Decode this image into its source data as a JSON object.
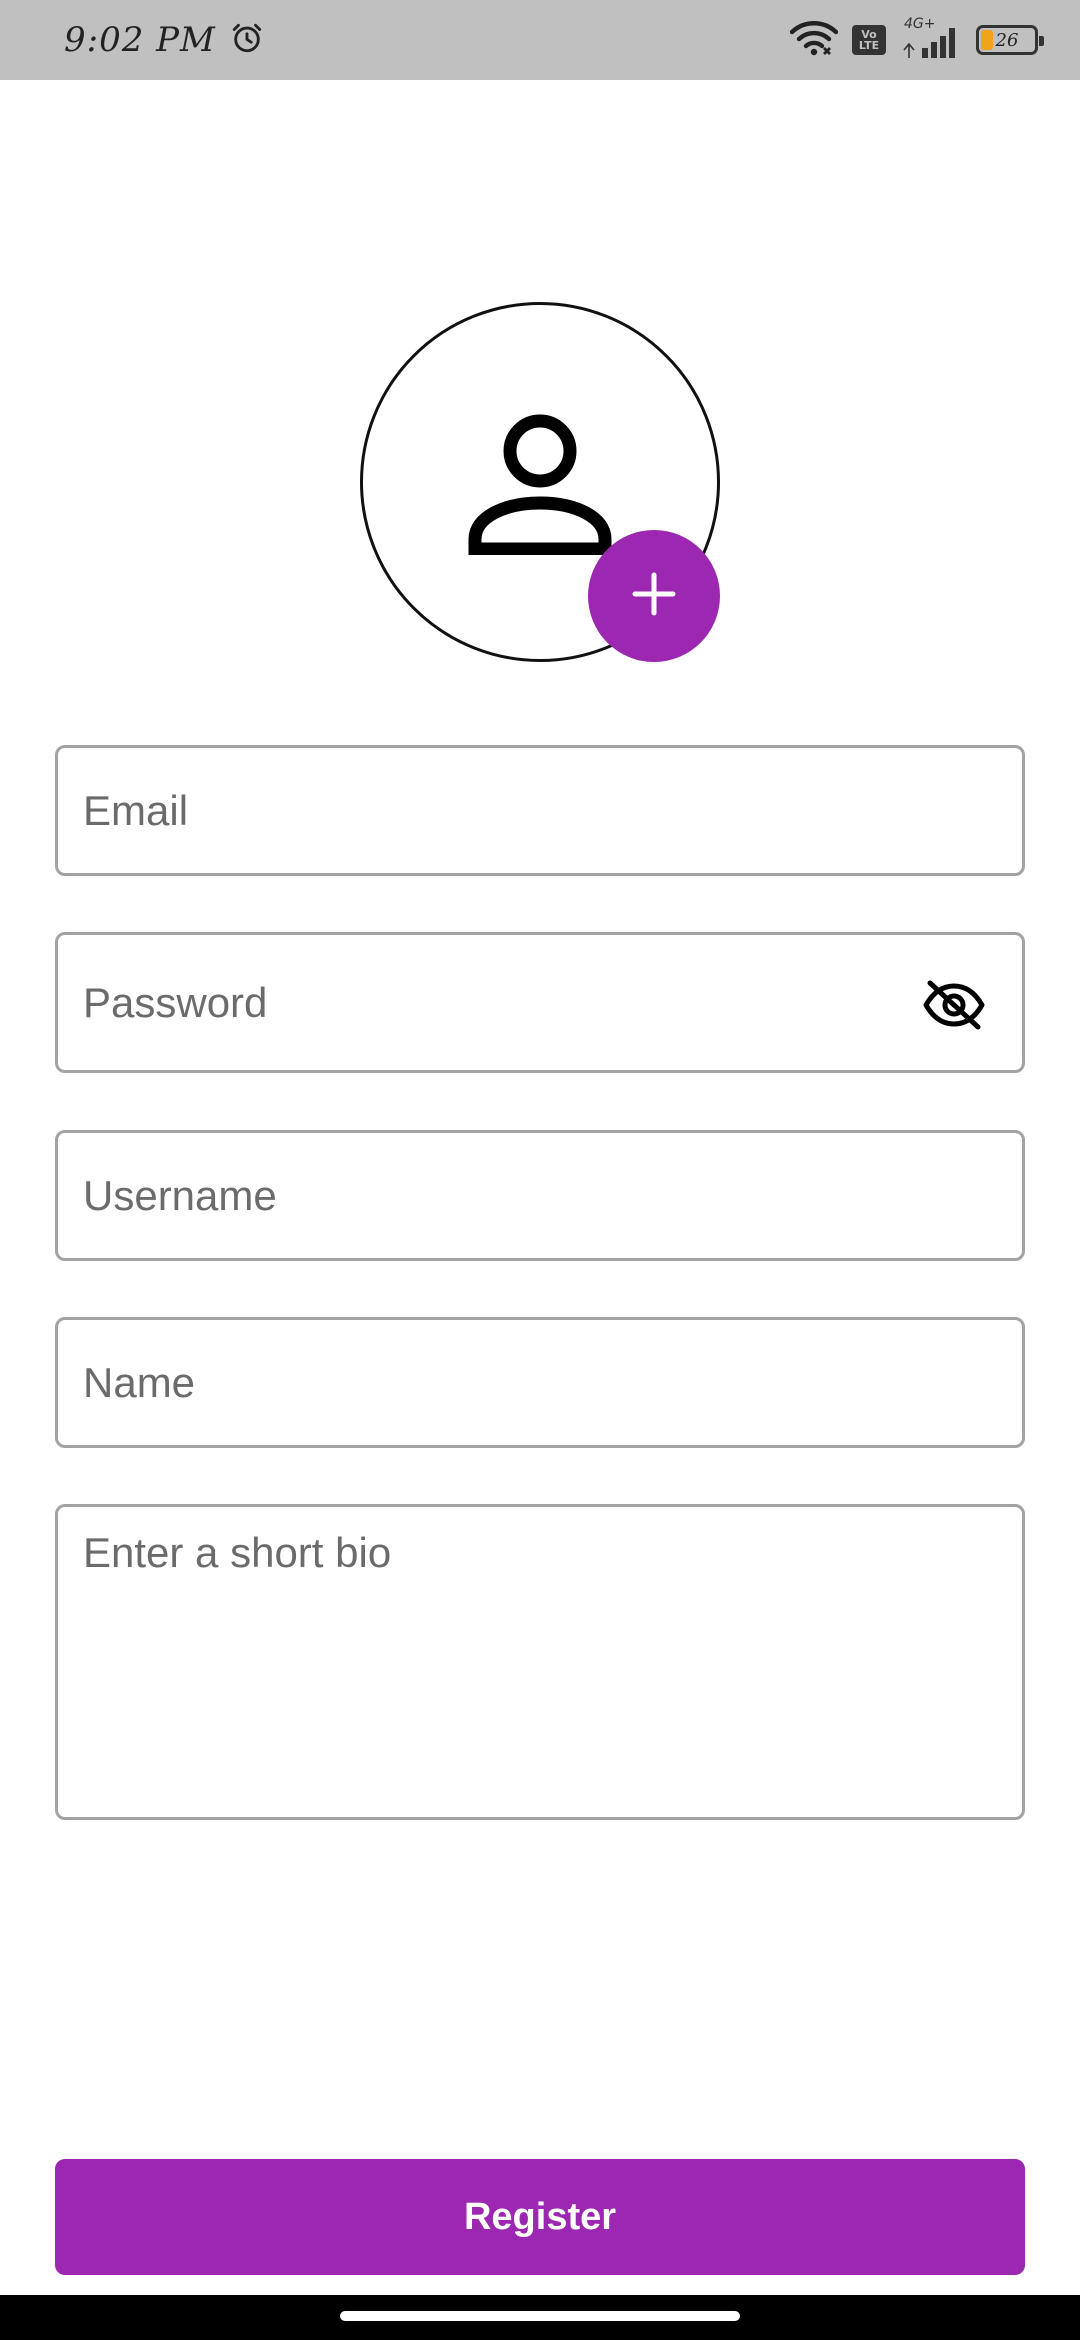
{
  "status_bar": {
    "time": "9:02 PM",
    "alarm_icon": "alarm-clock-icon",
    "wifi_icon": "wifi-icon",
    "volte_line1": "Vo",
    "volte_line2": "LTE",
    "network_type": "4G+",
    "signal_icon": "cell-signal-icon",
    "battery_level": "26"
  },
  "avatar": {
    "icon": "person-icon",
    "add_icon": "plus-icon"
  },
  "form": {
    "email_placeholder": "Email",
    "password_placeholder": "Password",
    "password_toggle_icon": "eye-off-icon",
    "username_placeholder": "Username",
    "name_placeholder": "Name",
    "bio_placeholder": "Enter a short bio"
  },
  "actions": {
    "register_label": "Register"
  },
  "colors": {
    "accent": "#9c27b0",
    "status_bar": "#c0c0c0",
    "field_border": "#a3a3a3",
    "placeholder": "#6b6b6b",
    "battery": "#f0a21a"
  }
}
